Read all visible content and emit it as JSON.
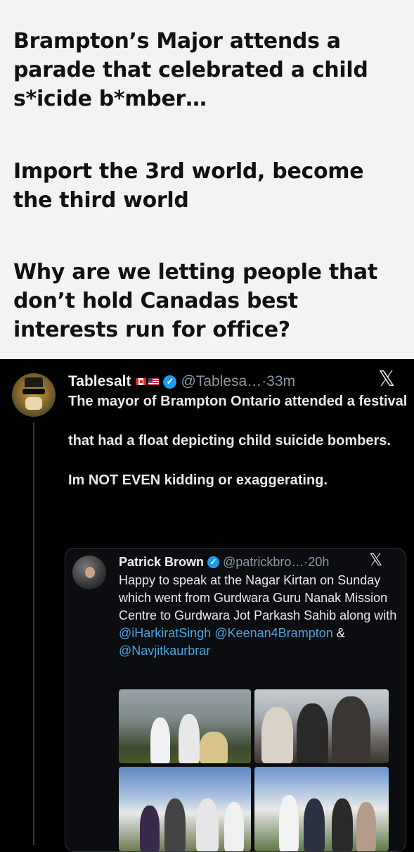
{
  "caption": {
    "paragraph1": "Brampton’s Major attends a parade that celebrated a child s*icide b*mber…",
    "paragraph2": "Import the 3rd world, become the third world",
    "paragraph3": "Why are we letting people that don’t hold Canadas best interests run for office?"
  },
  "tweet": {
    "display_name": "Tablesalt",
    "flags": [
      "canada-flag-icon",
      "us-flag-icon"
    ],
    "handle": "@Tablesa…",
    "time": "·33m",
    "x_logo": "𝕏",
    "lines": [
      "The mayor of Brampton Ontario attended a festival",
      "that had a float depicting child suicide bombers.",
      "Im NOT EVEN kidding or exaggerating."
    ]
  },
  "quoted_tweet": {
    "display_name": "Patrick Brown",
    "handle": "@patrickbro…",
    "time": "·20h",
    "x_logo": "𝕏",
    "text_before": "Happy to speak at the Nagar Kirtan on Sunday which went from Gurdwara Guru Nanak Mission Centre to Gurdwara Jot Parkash Sahib along with ",
    "mention1": "@iHarkiratSingh",
    "mention2": "@Keenan4Brampton",
    "ampersand": " &",
    "mention3": "@Navjitkaurbrar",
    "photo_count": 4
  },
  "colors": {
    "caption_bg": "#f3f3f3",
    "tweet_bg": "#000000",
    "verified": "#1d9bf0",
    "mention": "#4aa3df"
  }
}
